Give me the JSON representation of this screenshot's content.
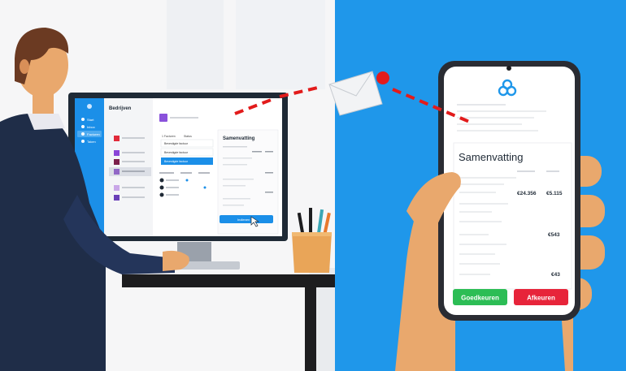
{
  "desktop": {
    "sidebar_items": [
      "Start",
      "Inbox",
      "Facturen",
      "Taken"
    ],
    "panel_title": "Bedrijven",
    "tabs": [
      "1 Facturen",
      "Status"
    ],
    "rows": [
      "Bevestigde factuur",
      "Bevestigde factuur",
      "Bevestigde factuur"
    ],
    "summary_title": "Samenvatting",
    "action_label": "Indienen"
  },
  "phone": {
    "summary_title": "Samenvatting",
    "amounts": [
      "€24.356",
      "€5.115",
      "€543",
      "€43"
    ],
    "approve_label": "Goedkeuren",
    "reject_label": "Afkeuren"
  },
  "colors": {
    "right_bg": "#1f97ea",
    "approve": "#2cbd55",
    "reject": "#e7243a",
    "dash": "#e21b1b",
    "skin": "#e9a86d",
    "desk": "#1d1d1f"
  }
}
